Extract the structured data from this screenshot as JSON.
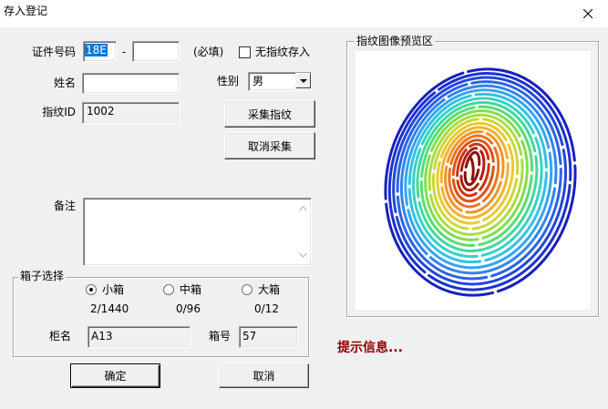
{
  "window": {
    "title": "存入登记"
  },
  "form": {
    "id_label": "证件号码",
    "id_prefix_value": "18E",
    "id_separator": "-",
    "id_suffix_value": "",
    "required_note": "(必填)",
    "no_fp_label": "无指纹存入",
    "no_fp_checked": false,
    "name_label": "姓名",
    "name_value": "",
    "gender_label": "性别",
    "gender_value": "男",
    "fp_id_label": "指纹ID",
    "fp_id_value": "1002",
    "capture_button": "采集指纹",
    "cancel_capture_button": "取消采集",
    "remark_label": "备注",
    "remark_value": ""
  },
  "box_select": {
    "title": "箱子选择",
    "options": [
      {
        "label": "小箱",
        "count": "2/1440",
        "selected": true
      },
      {
        "label": "中箱",
        "count": "0/96",
        "selected": false
      },
      {
        "label": "大箱",
        "count": "0/12",
        "selected": false
      }
    ],
    "cabinet_label": "柜名",
    "cabinet_value": "A13",
    "box_no_label": "箱号",
    "box_no_value": "57"
  },
  "buttons": {
    "ok": "确定",
    "cancel": "取消"
  },
  "preview": {
    "title": "指纹图像预览区"
  },
  "hint": {
    "text": "提示信息..."
  },
  "colors": {
    "hint_text": "#8b0000",
    "selection_highlight": "#0078d7"
  }
}
